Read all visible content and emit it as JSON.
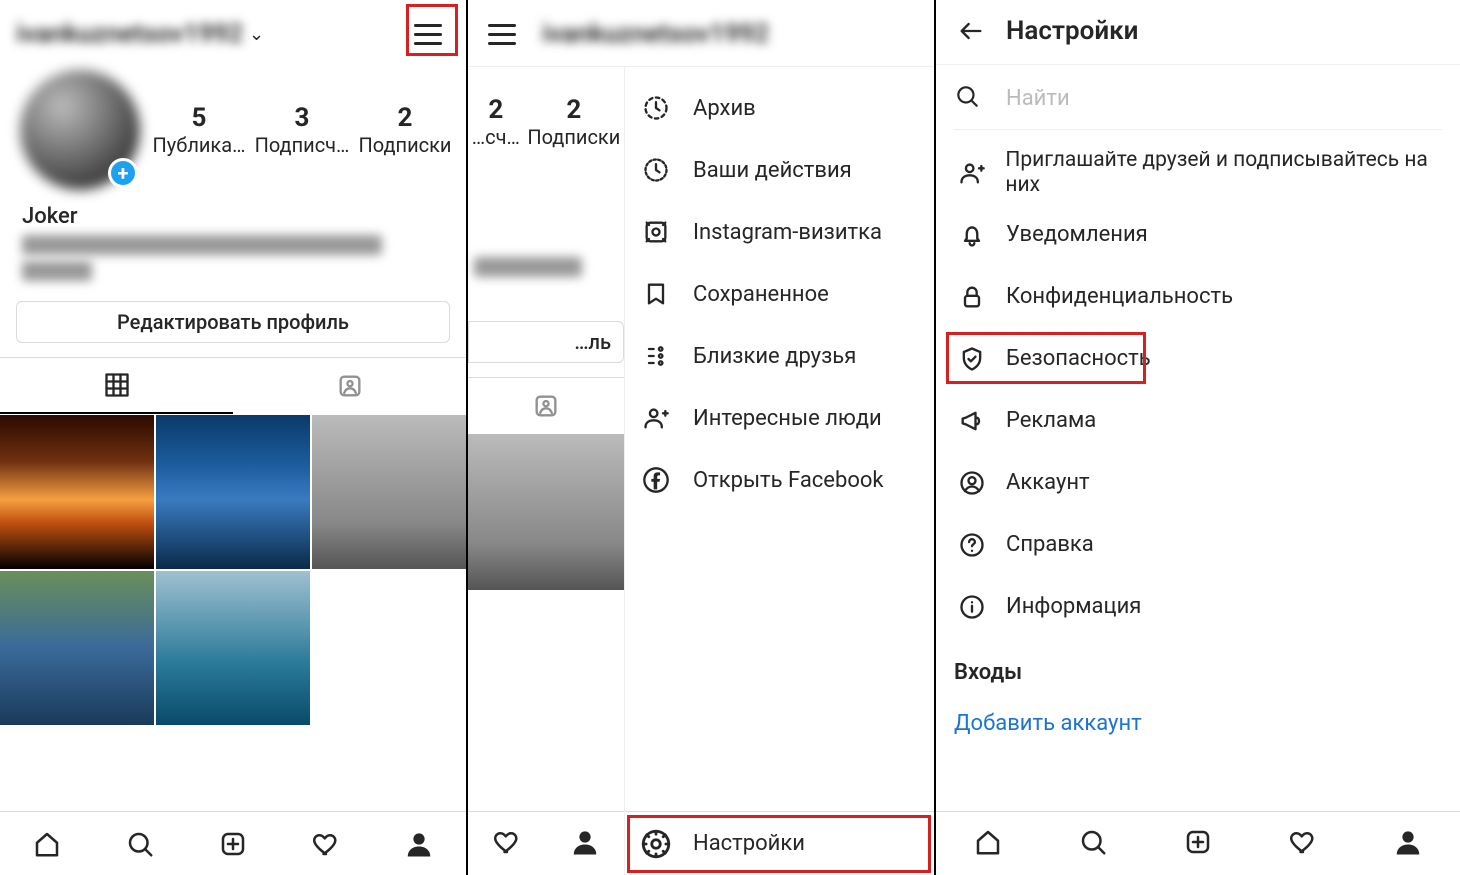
{
  "pane1": {
    "username": "ivankuznetsov1992",
    "stats": [
      {
        "n": "5",
        "label": "Публика…"
      },
      {
        "n": "3",
        "label": "Подписч…"
      },
      {
        "n": "2",
        "label": "Подписки"
      }
    ],
    "display_name": "Joker",
    "edit_profile": "Редактировать профиль"
  },
  "pane2": {
    "username": "ivankuznetsov1992",
    "stats_frag": [
      {
        "n": "2",
        "label": "…сч…"
      },
      {
        "n": "2",
        "label": "Подписки"
      }
    ],
    "edit_frag": "…ль",
    "drawer_items": [
      {
        "icon": "archive-icon",
        "label": "Архив"
      },
      {
        "icon": "activity-icon",
        "label": "Ваши действия"
      },
      {
        "icon": "nametag-icon",
        "label": "Instagram-визитка"
      },
      {
        "icon": "bookmark-icon",
        "label": "Сохраненное"
      },
      {
        "icon": "close-friends-icon",
        "label": "Близкие друзья"
      },
      {
        "icon": "discover-people-icon",
        "label": "Интересные люди"
      },
      {
        "icon": "facebook-icon",
        "label": "Открыть Facebook"
      }
    ],
    "footer": {
      "icon": "settings-gear-icon",
      "label": "Настройки"
    }
  },
  "pane3": {
    "title": "Настройки",
    "search_placeholder": "Найти",
    "items": [
      {
        "icon": "invite-friends-icon",
        "label": "Приглашайте друзей и подписывайтесь на них",
        "two": true
      },
      {
        "icon": "bell-icon",
        "label": "Уведомления"
      },
      {
        "icon": "lock-icon",
        "label": "Конфиденциальность"
      },
      {
        "icon": "shield-check-icon",
        "label": "Безопасность"
      },
      {
        "icon": "megaphone-icon",
        "label": "Реклама"
      },
      {
        "icon": "account-icon",
        "label": "Аккаунт"
      },
      {
        "icon": "help-icon",
        "label": "Справка"
      },
      {
        "icon": "info-icon",
        "label": "Информация"
      }
    ],
    "section_label": "Входы",
    "add_account": "Добавить аккаунт"
  }
}
